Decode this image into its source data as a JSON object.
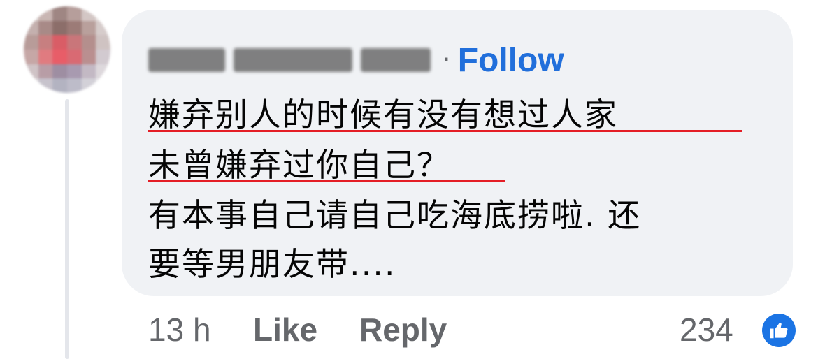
{
  "comment": {
    "author_name_blurred": "Ξ■■■ ■■■■■■ ■■■■",
    "separator": "·",
    "follow_label": "Follow",
    "text_lines": [
      "嫌弃别人的时候有没有想过人家",
      "未曾嫌弃过你自己？",
      "有本事自己请自己吃海底捞啦. 还",
      "要等男朋友带...."
    ]
  },
  "footer": {
    "time": "13 h",
    "like_label": "Like",
    "reply_label": "Reply",
    "reaction_count": "234",
    "reaction_icon": "thumbs-up-icon"
  },
  "colors": {
    "bubble": "#f0f2f5",
    "link": "#216fdb",
    "meta": "#65676b",
    "underline": "#e41e26",
    "reaction": "#1b74e4"
  }
}
